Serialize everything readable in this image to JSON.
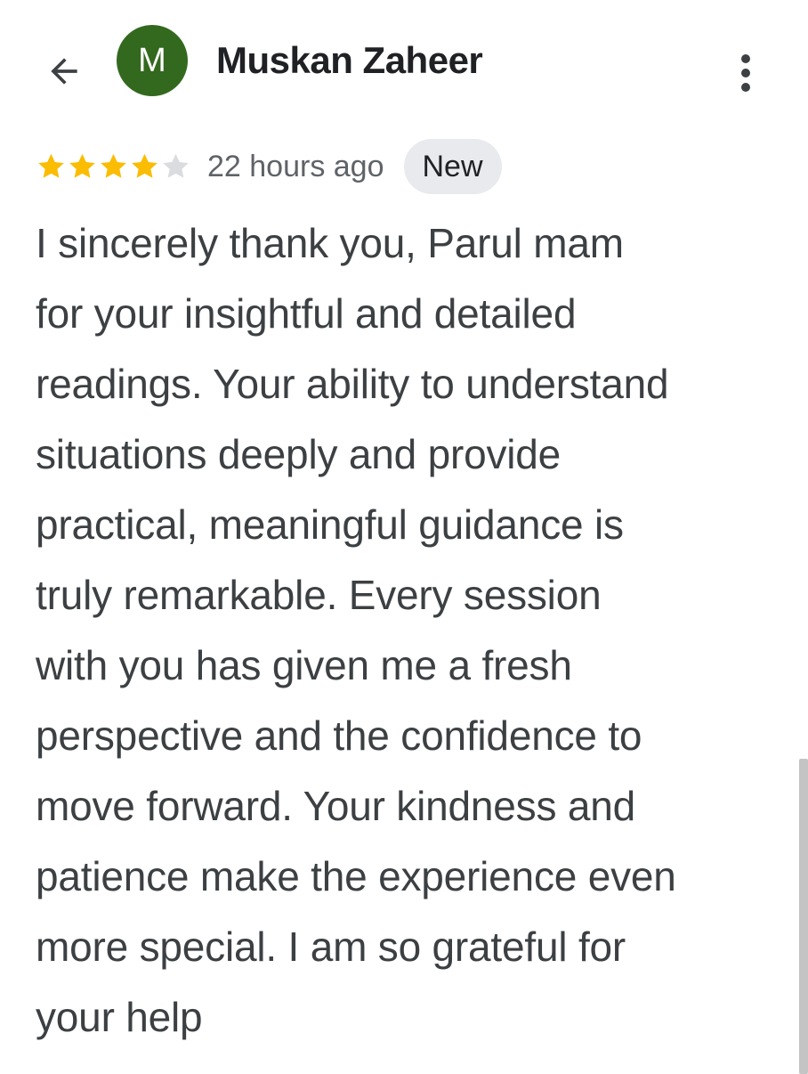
{
  "reviewer": {
    "name": "Muskan Zaheer",
    "avatar_initial": "M",
    "avatar_color": "#33691e"
  },
  "icons": {
    "back": "arrow-back-icon",
    "more": "more-vert-icon",
    "star": "star-icon"
  },
  "rating": {
    "value": 4,
    "max": 5,
    "filled_color": "#fbbc04",
    "empty_color": "#dadce0"
  },
  "review": {
    "time": "22 hours ago",
    "badge": "New",
    "lines": [
      "I sincerely thank you, Parul mam",
      "for your insightful and detailed",
      "readings. Your ability to understand",
      "situations deeply and provide",
      "practical, meaningful guidance is",
      "truly remarkable. Every session",
      "with you has given me a fresh",
      "perspective and the confidence to",
      "move forward. Your kindness and",
      "patience make the experience even",
      "more special. I am so grateful for",
      "your help"
    ]
  }
}
